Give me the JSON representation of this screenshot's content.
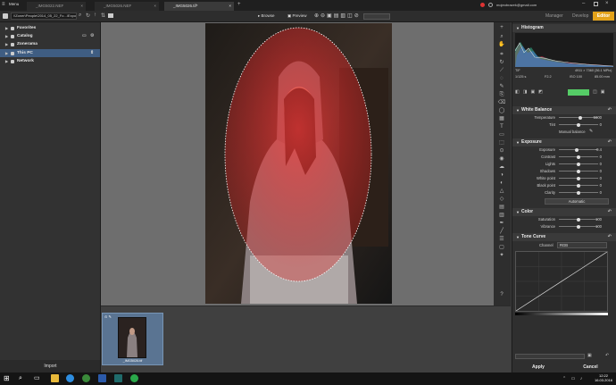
{
  "titlebar": {
    "menu": "Menu",
    "tabs": [
      {
        "label": "_IMG5022.NEF"
      },
      {
        "label": "_IMG5026.NEF"
      },
      {
        "label": "_IMG5026.tif*"
      }
    ],
    "add": "+",
    "user": "mojeobrazek@gmail.com"
  },
  "toolbar": {
    "path": "\\\\Zoner\\People\\2014_05_22_Fo...\\Export",
    "browse": "Browse",
    "preview": "Preview",
    "modes": [
      "Manager",
      "Develop",
      "Editor"
    ]
  },
  "left": {
    "items": [
      {
        "label": "Favorites"
      },
      {
        "label": "Catalog"
      },
      {
        "label": "Zonerama"
      },
      {
        "label": "This PC"
      },
      {
        "label": "Network"
      }
    ],
    "import": "Import"
  },
  "center": {
    "dims": "4911 × 7360 × 48"
  },
  "filmstrip": {
    "thumb_label": "_IMG5026.tif"
  },
  "right": {
    "histogram": {
      "title": "Histogram",
      "format": "TIF",
      "dims": "4911 × 7360 (36.1 MPix)",
      "info": [
        "1/125 s",
        "F2.2",
        "ISO 100",
        "85.00 mm"
      ]
    },
    "white_balance": {
      "title": "White Balance",
      "rows": [
        {
          "label": "Temperature",
          "value": "5600",
          "pos": 0.55
        },
        {
          "label": "Tint",
          "value": "0",
          "pos": 0.5
        }
      ],
      "manual": "Manual balance"
    },
    "exposure": {
      "title": "Exposure",
      "rows": [
        {
          "label": "Exposure",
          "value": "-0.4",
          "pos": 0.45
        },
        {
          "label": "Contrast",
          "value": "0",
          "pos": 0.5
        },
        {
          "label": "Lights",
          "value": "0",
          "pos": 0.5
        },
        {
          "label": "Shadows",
          "value": "0",
          "pos": 0.5
        },
        {
          "label": "White point",
          "value": "0",
          "pos": 0.5
        },
        {
          "label": "Black point",
          "value": "0",
          "pos": 0.5
        },
        {
          "label": "Clarity",
          "value": "0",
          "pos": 0.5
        }
      ],
      "auto": "Automatic"
    },
    "color": {
      "title": "Color",
      "rows": [
        {
          "label": "Saturation",
          "value": "100",
          "pos": 0.5
        },
        {
          "label": "Vibrance",
          "value": "100",
          "pos": 0.5
        }
      ]
    },
    "tone_curve": {
      "title": "Tone Curve",
      "channel_label": "Channel",
      "channel_value": "RGB"
    },
    "apply": "Apply",
    "cancel": "Cancel"
  },
  "taskbar": {
    "time": "12:22",
    "date": "16.03.2016"
  }
}
